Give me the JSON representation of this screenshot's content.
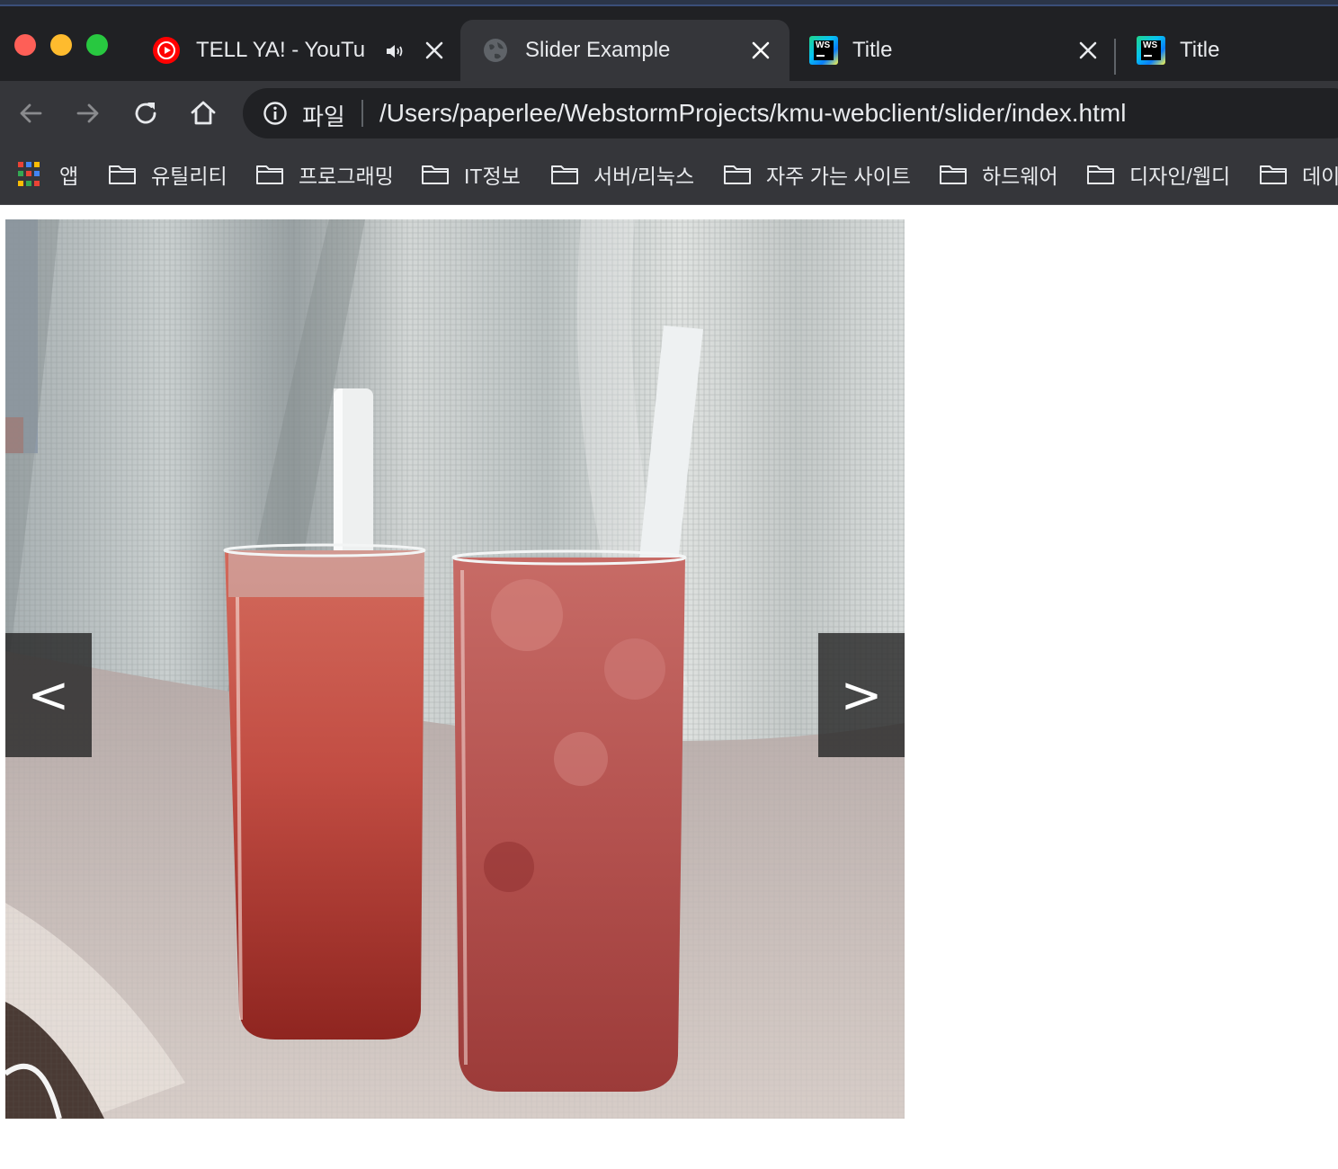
{
  "window": {
    "tabs": [
      {
        "title": "TELL YA! - YouTu",
        "favicon": "youtube-icon",
        "audio": true,
        "active": false
      },
      {
        "title": "Slider Example",
        "favicon": "globe-icon",
        "active": true
      },
      {
        "title": "Title",
        "favicon": "webstorm-icon",
        "active": false
      },
      {
        "title": "Title",
        "favicon": "webstorm-icon",
        "active": false
      }
    ]
  },
  "toolbar": {
    "scheme_label": "파일",
    "url": "/Users/paperlee/WebstormProjects/kmu-webclient/slider/index.html"
  },
  "bookmarks": {
    "apps_label": "앱",
    "folders": [
      "유틸리티",
      "프로그래밍",
      "IT정보",
      "서버/리눅스",
      "자주 가는 사이트",
      "하드웨어",
      "디자인/웹디",
      "데이"
    ]
  },
  "slider": {
    "prev_label": "<",
    "next_label": ">"
  },
  "colors": {
    "chrome_bg": "#202124",
    "toolbar_bg": "#35363a",
    "text": "#e8eaed",
    "traffic_red": "#fe5f57",
    "traffic_yellow": "#febb2e",
    "traffic_green": "#28c840"
  }
}
